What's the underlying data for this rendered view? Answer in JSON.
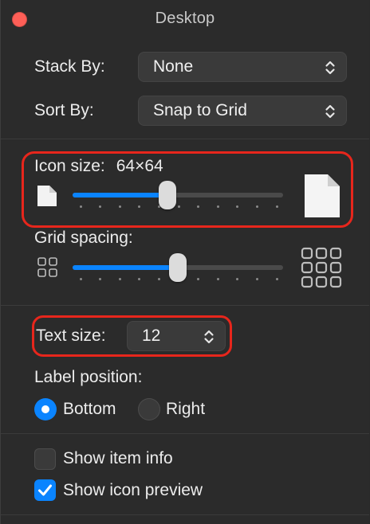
{
  "window": {
    "title": "Desktop"
  },
  "stack_by": {
    "label": "Stack By:",
    "value": "None"
  },
  "sort_by": {
    "label": "Sort By:",
    "value": "Snap to Grid"
  },
  "icon_size": {
    "label": "Icon size:",
    "value_text": "64×64",
    "level": 0.45
  },
  "grid_spacing": {
    "label": "Grid spacing:",
    "level": 0.5
  },
  "text_size": {
    "label": "Text size:",
    "value": "12"
  },
  "label_position": {
    "label": "Label position:",
    "options": [
      {
        "label": "Bottom",
        "selected": true
      },
      {
        "label": "Right",
        "selected": false
      }
    ]
  },
  "show_item_info": {
    "label": "Show item info",
    "checked": false
  },
  "show_icon_preview": {
    "label": "Show icon preview",
    "checked": true
  },
  "colors": {
    "accent": "#0a84ff",
    "highlight": "#e7261c",
    "close": "#fe5f57"
  }
}
